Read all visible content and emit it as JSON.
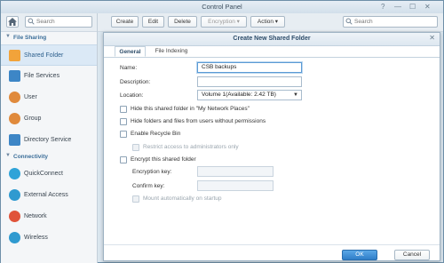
{
  "window": {
    "title": "Control Panel"
  },
  "sidebar": {
    "search_placeholder": "Search",
    "sections": [
      {
        "label": "File Sharing"
      },
      {
        "label": "Connectivity"
      }
    ],
    "items": [
      {
        "label": "Shared Folder",
        "icon": "shared-folder-icon",
        "color": "#f2a33a"
      },
      {
        "label": "File Services",
        "icon": "file-services-icon",
        "color": "#3d86c6"
      },
      {
        "label": "User",
        "icon": "user-icon",
        "color": "#e08a3c"
      },
      {
        "label": "Group",
        "icon": "group-icon",
        "color": "#e08a3c"
      },
      {
        "label": "Directory Service",
        "icon": "directory-service-icon",
        "color": "#3d86c6"
      },
      {
        "label": "QuickConnect",
        "icon": "quickconnect-icon",
        "color": "#2fa3d8"
      },
      {
        "label": "External Access",
        "icon": "external-access-icon",
        "color": "#2f9ad0"
      },
      {
        "label": "Network",
        "icon": "network-icon",
        "color": "#e0533a"
      },
      {
        "label": "Wireless",
        "icon": "wireless-icon",
        "color": "#2f9ad0"
      }
    ]
  },
  "toolbar": {
    "create": "Create",
    "edit": "Edit",
    "delete": "Delete",
    "encryption": "Encryption ▾",
    "action": "Action ▾",
    "search_placeholder": "Search"
  },
  "dialog": {
    "title": "Create New Shared Folder",
    "tabs": [
      "General",
      "File Indexing"
    ],
    "fields": {
      "name_label": "Name:",
      "name_value": "CSB backups",
      "description_label": "Description:",
      "description_value": "",
      "location_label": "Location:",
      "location_value": "Volume 1(Available: 2.42 TB)"
    },
    "checkboxes": {
      "hide_network_places": "Hide this shared folder in \"My Network Places\"",
      "hide_without_permission": "Hide folders and files from users without permissions",
      "enable_recycle_bin": "Enable Recycle Bin",
      "restrict_admin": "Restrict access to administrators only",
      "encrypt": "Encrypt this shared folder",
      "mount_auto": "Mount automatically on startup"
    },
    "encryption_key_label": "Encryption key:",
    "confirm_key_label": "Confirm key:",
    "ok": "OK",
    "cancel": "Cancel"
  }
}
